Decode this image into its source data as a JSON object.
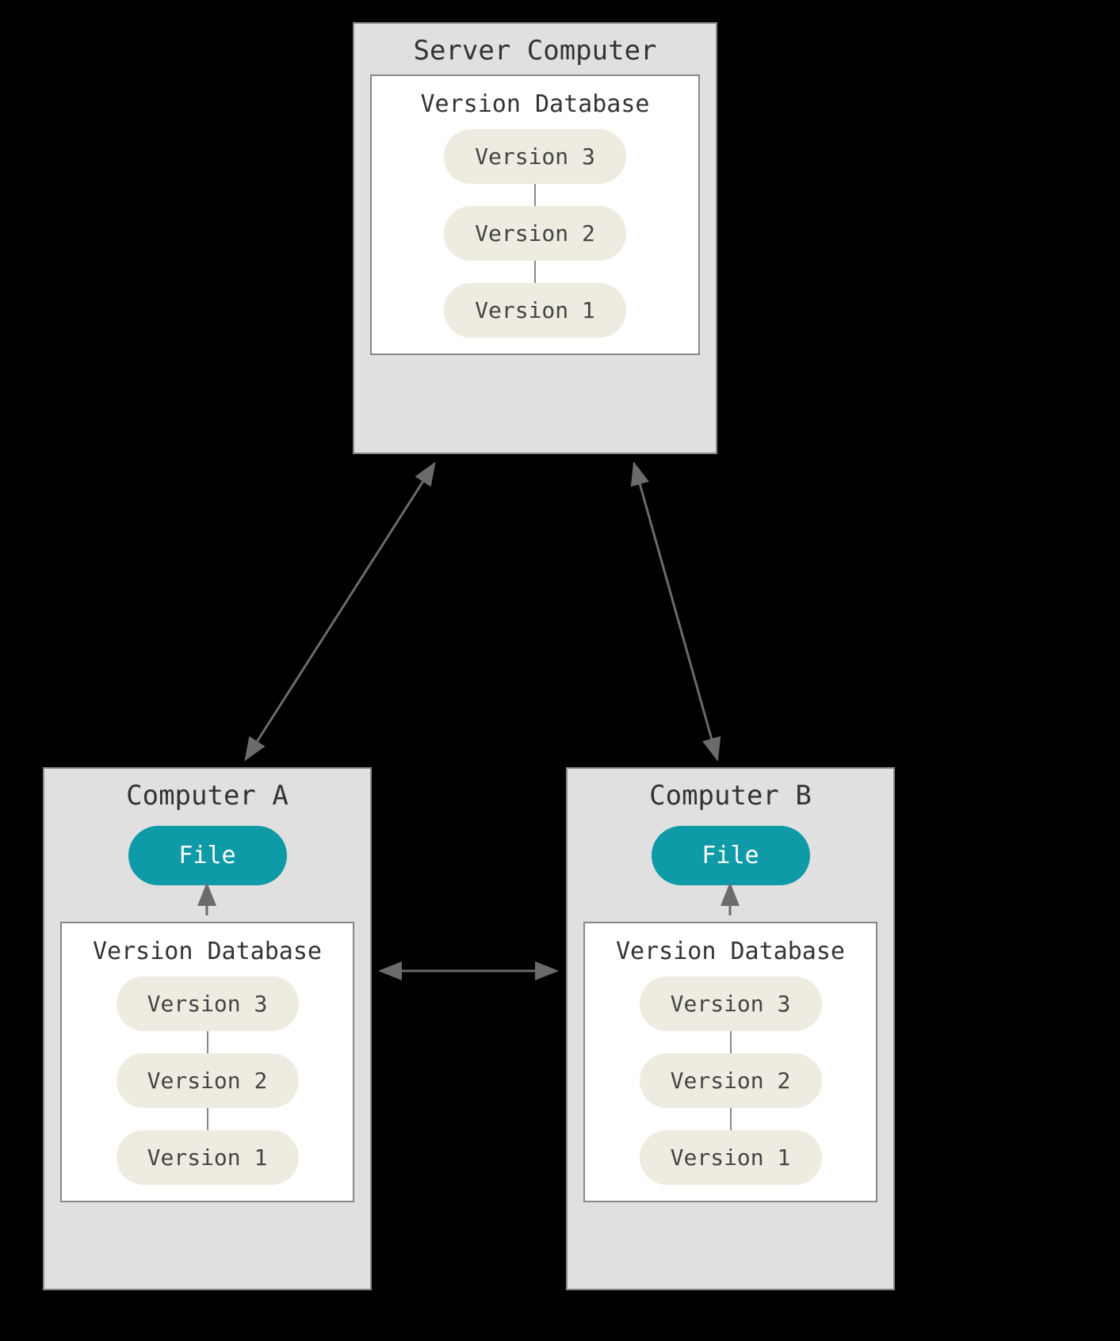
{
  "server": {
    "title": "Server Computer",
    "db_title": "Version Database",
    "v3": "Version 3",
    "v2": "Version 2",
    "v1": "Version 1"
  },
  "computer_a": {
    "title": "Computer A",
    "file_label": "File",
    "db_title": "Version Database",
    "v3": "Version 3",
    "v2": "Version 2",
    "v1": "Version 1"
  },
  "computer_b": {
    "title": "Computer B",
    "file_label": "File",
    "db_title": "Version Database",
    "v3": "Version 3",
    "v2": "Version 2",
    "v1": "Version 1"
  },
  "colors": {
    "box_bg": "#e0e0e0",
    "box_border": "#888888",
    "db_bg": "#ffffff",
    "pill_bg": "#eeece1",
    "file_bg": "#0e9aa7",
    "arrow": "#6b6b6b"
  }
}
